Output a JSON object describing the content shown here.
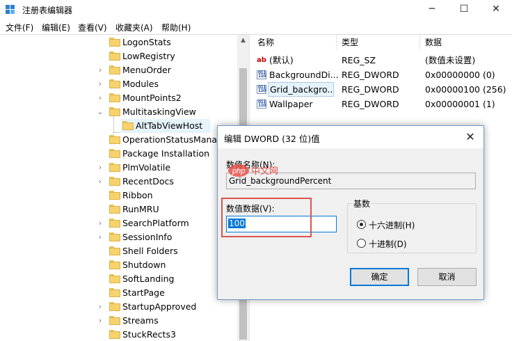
{
  "window": {
    "title": "注册表编辑器",
    "controls": {
      "minimize": "─",
      "maximize": "☐",
      "close": "✕"
    }
  },
  "menu": [
    "文件(F)",
    "编辑(E)",
    "查看(V)",
    "收藏夹(A)",
    "帮助(H)"
  ],
  "tree": {
    "items": [
      {
        "label": "LogonStats",
        "arrow": ""
      },
      {
        "label": "LowRegistry",
        "arrow": ""
      },
      {
        "label": "MenuOrder",
        "arrow": "›"
      },
      {
        "label": "Modules",
        "arrow": "›"
      },
      {
        "label": "MountPoints2",
        "arrow": "›"
      },
      {
        "label": "MultitaskingView",
        "arrow": "⌄"
      },
      {
        "label": "AltTabViewHost",
        "arrow": "",
        "child": true,
        "selected": true
      },
      {
        "label": "OperationStatusManag",
        "arrow": ""
      },
      {
        "label": "Package Installation",
        "arrow": ""
      },
      {
        "label": "PlmVolatile",
        "arrow": "›"
      },
      {
        "label": "RecentDocs",
        "arrow": "›"
      },
      {
        "label": "Ribbon",
        "arrow": ""
      },
      {
        "label": "RunMRU",
        "arrow": ""
      },
      {
        "label": "SearchPlatform",
        "arrow": "›"
      },
      {
        "label": "SessionInfo",
        "arrow": "›"
      },
      {
        "label": "Shell Folders",
        "arrow": ""
      },
      {
        "label": "Shutdown",
        "arrow": ""
      },
      {
        "label": "SoftLanding",
        "arrow": ""
      },
      {
        "label": "StartPage",
        "arrow": ""
      },
      {
        "label": "StartupApproved",
        "arrow": "›"
      },
      {
        "label": "Streams",
        "arrow": "›"
      },
      {
        "label": "StuckRects3",
        "arrow": ""
      }
    ]
  },
  "values": {
    "headers": {
      "name": "名称",
      "type": "类型",
      "data": "数据"
    },
    "rows": [
      {
        "icon": "string-value-icon",
        "name": "(默认)",
        "type": "REG_SZ",
        "data": "(数值未设置)"
      },
      {
        "icon": "binary-value-icon",
        "name": "BackgroundDi...",
        "type": "REG_DWORD",
        "data": "0x00000000 (0)"
      },
      {
        "icon": "binary-value-icon",
        "name": "Grid_backgro...",
        "type": "REG_DWORD",
        "data": "0x00000100 (256)",
        "selected": true
      },
      {
        "icon": "binary-value-icon",
        "name": "Wallpaper",
        "type": "REG_DWORD",
        "data": "0x00000001 (1)"
      }
    ]
  },
  "dialog": {
    "title": "编辑 DWORD (32 位)值",
    "close": "✕",
    "name_label": "数值名称(N):",
    "name_value": "Grid_backgroundPercent",
    "data_label": "数值数据(V):",
    "data_value": "100",
    "base_title": "基数",
    "base_options": [
      {
        "label": "十六进制(H)",
        "checked": true
      },
      {
        "label": "十进制(D)",
        "checked": false
      }
    ],
    "ok": "确定",
    "cancel": "取消"
  },
  "watermark": {
    "text": "中文网",
    "prefix": "php"
  },
  "colors": {
    "accent": "#0078d7",
    "selection": "#e5f3fb",
    "highlight_box": "#d9544f",
    "folder": "#f6d36c"
  }
}
